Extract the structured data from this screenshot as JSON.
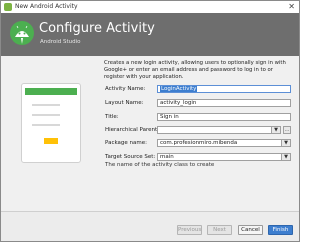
{
  "window": {
    "title": "New Android Activity"
  },
  "header": {
    "title": "Configure Activity",
    "subtitle": "Android Studio"
  },
  "description": "Creates a new login activity, allowing users to optionally sign in with Google+ or enter an email address and password to log in to or register with your application.",
  "form": {
    "activity_name_label": "Activity Name:",
    "activity_name_value": "LoginActivity",
    "layout_name_label": "Layout Name:",
    "layout_name_value": "activity_login",
    "title_label": "Title:",
    "title_value": "Sign in",
    "hierarchical_parent_label": "Hierarchical Parent:",
    "hierarchical_parent_value": "",
    "package_name_label": "Package name:",
    "package_name_value": "com.profesionmiro.mibenda",
    "target_source_set_label": "Target Source Set:",
    "target_source_set_value": "main"
  },
  "hint": "The name of the activity class to create",
  "footer": {
    "previous": "Previous",
    "next": "Next",
    "cancel": "Cancel",
    "finish": "Finish"
  },
  "icons": {
    "dropdown": "▼",
    "browse": "…",
    "close": "✕"
  },
  "colors": {
    "header_bg": "#6e6e6e",
    "primary_button": "#3d7ecf",
    "preview_bar": "#4caf50",
    "preview_button": "#ffc107"
  }
}
